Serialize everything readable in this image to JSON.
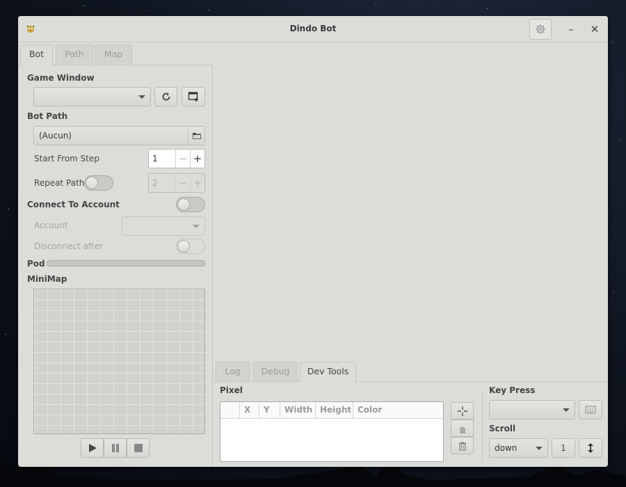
{
  "window": {
    "title": "Dindo Bot"
  },
  "left_tabs": [
    {
      "label": "Bot",
      "active": true
    },
    {
      "label": "Path",
      "active": false
    },
    {
      "label": "Map",
      "active": false
    }
  ],
  "bot": {
    "game_window_label": "Game Window",
    "game_window_value": "",
    "bot_path_label": "Bot Path",
    "bot_path_value": "(Aucun)",
    "start_from_step_label": "Start From Step",
    "start_from_step_value": "1",
    "repeat_path_label": "Repeat Path",
    "repeat_path_value": "2",
    "repeat_path_enabled": false,
    "connect_to_account_label": "Connect To Account",
    "connect_to_account_enabled": false,
    "account_label": "Account",
    "account_value": "",
    "disconnect_after_label": "Disconnect after",
    "disconnect_after_enabled": false,
    "pod_label": "Pod",
    "pod_fraction": 0,
    "minimap_label": "MiniMap"
  },
  "right_tabs": [
    {
      "label": "Log",
      "active": false
    },
    {
      "label": "Debug",
      "active": false
    },
    {
      "label": "Dev Tools",
      "active": true
    }
  ],
  "dev_tools": {
    "pixel_label": "Pixel",
    "columns": [
      "",
      "X",
      "Y",
      "Width",
      "Height",
      "Color"
    ],
    "rows": [],
    "key_press_label": "Key Press",
    "key_press_value": "",
    "scroll_label": "Scroll",
    "scroll_direction": "down",
    "scroll_count": "1"
  },
  "icons": {
    "app": "dindo-bot-icon",
    "settings": "gear-icon",
    "minimize": "minimize-icon",
    "close": "close-icon",
    "refresh": "refresh-icon",
    "new_window": "new-window-icon",
    "folder": "folder-icon",
    "play": "play-icon",
    "pause": "pause-icon",
    "stop": "stop-icon",
    "crosshair": "crosshair-icon",
    "hand": "hand-pointer-icon",
    "trash": "trash-icon",
    "keyboard": "keyboard-icon",
    "scroll": "vertical-arrows-icon"
  },
  "colors": {
    "window_bg": "#dcddd9",
    "accent": "#6b8bb3"
  }
}
